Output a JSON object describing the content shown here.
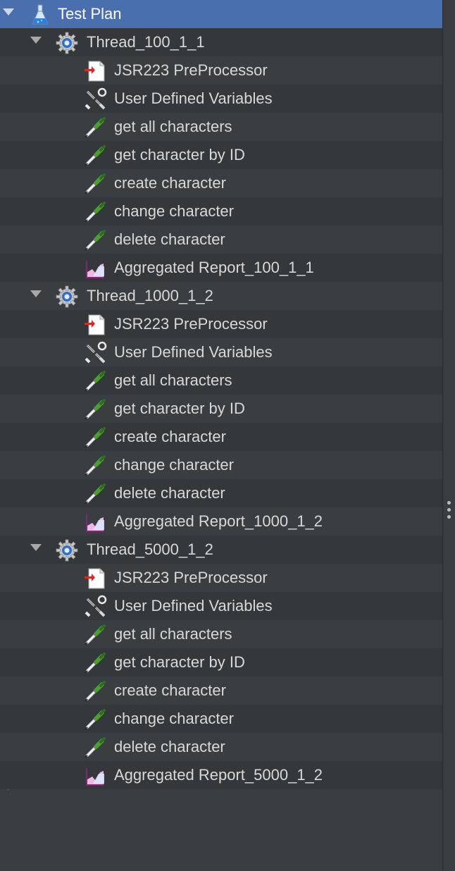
{
  "root": {
    "label": "Test Plan"
  },
  "groups": [
    {
      "label": "Thread_100_1_1",
      "children": [
        {
          "label": "JSR223 PreProcessor",
          "icon": "preprocessor-icon"
        },
        {
          "label": "User Defined Variables",
          "icon": "config-tools-icon"
        },
        {
          "label": "get all characters",
          "icon": "sampler-pipette-icon"
        },
        {
          "label": "get character by ID",
          "icon": "sampler-pipette-icon"
        },
        {
          "label": "create character",
          "icon": "sampler-pipette-icon"
        },
        {
          "label": "change character",
          "icon": "sampler-pipette-icon"
        },
        {
          "label": "delete character",
          "icon": "sampler-pipette-icon"
        },
        {
          "label": "Aggregated Report_100_1_1",
          "icon": "report-chart-icon"
        }
      ]
    },
    {
      "label": "Thread_1000_1_2",
      "children": [
        {
          "label": "JSR223 PreProcessor",
          "icon": "preprocessor-icon"
        },
        {
          "label": "User Defined Variables",
          "icon": "config-tools-icon"
        },
        {
          "label": "get all characters",
          "icon": "sampler-pipette-icon"
        },
        {
          "label": "get character by ID",
          "icon": "sampler-pipette-icon"
        },
        {
          "label": "create character",
          "icon": "sampler-pipette-icon"
        },
        {
          "label": "change character",
          "icon": "sampler-pipette-icon"
        },
        {
          "label": "delete character",
          "icon": "sampler-pipette-icon"
        },
        {
          "label": "Aggregated Report_1000_1_2",
          "icon": "report-chart-icon"
        }
      ]
    },
    {
      "label": "Thread_5000_1_2",
      "children": [
        {
          "label": "JSR223 PreProcessor",
          "icon": "preprocessor-icon"
        },
        {
          "label": "User Defined Variables",
          "icon": "config-tools-icon"
        },
        {
          "label": "get all characters",
          "icon": "sampler-pipette-icon"
        },
        {
          "label": "get character by ID",
          "icon": "sampler-pipette-icon"
        },
        {
          "label": "create character",
          "icon": "sampler-pipette-icon"
        },
        {
          "label": "change character",
          "icon": "sampler-pipette-icon"
        },
        {
          "label": "delete character",
          "icon": "sampler-pipette-icon"
        },
        {
          "label": "Aggregated Report_5000_1_2",
          "icon": "report-chart-icon"
        }
      ]
    }
  ],
  "colors": {
    "selection": "#4a6fae",
    "background": "#3b3e40",
    "guide": "#5b8fc7"
  }
}
